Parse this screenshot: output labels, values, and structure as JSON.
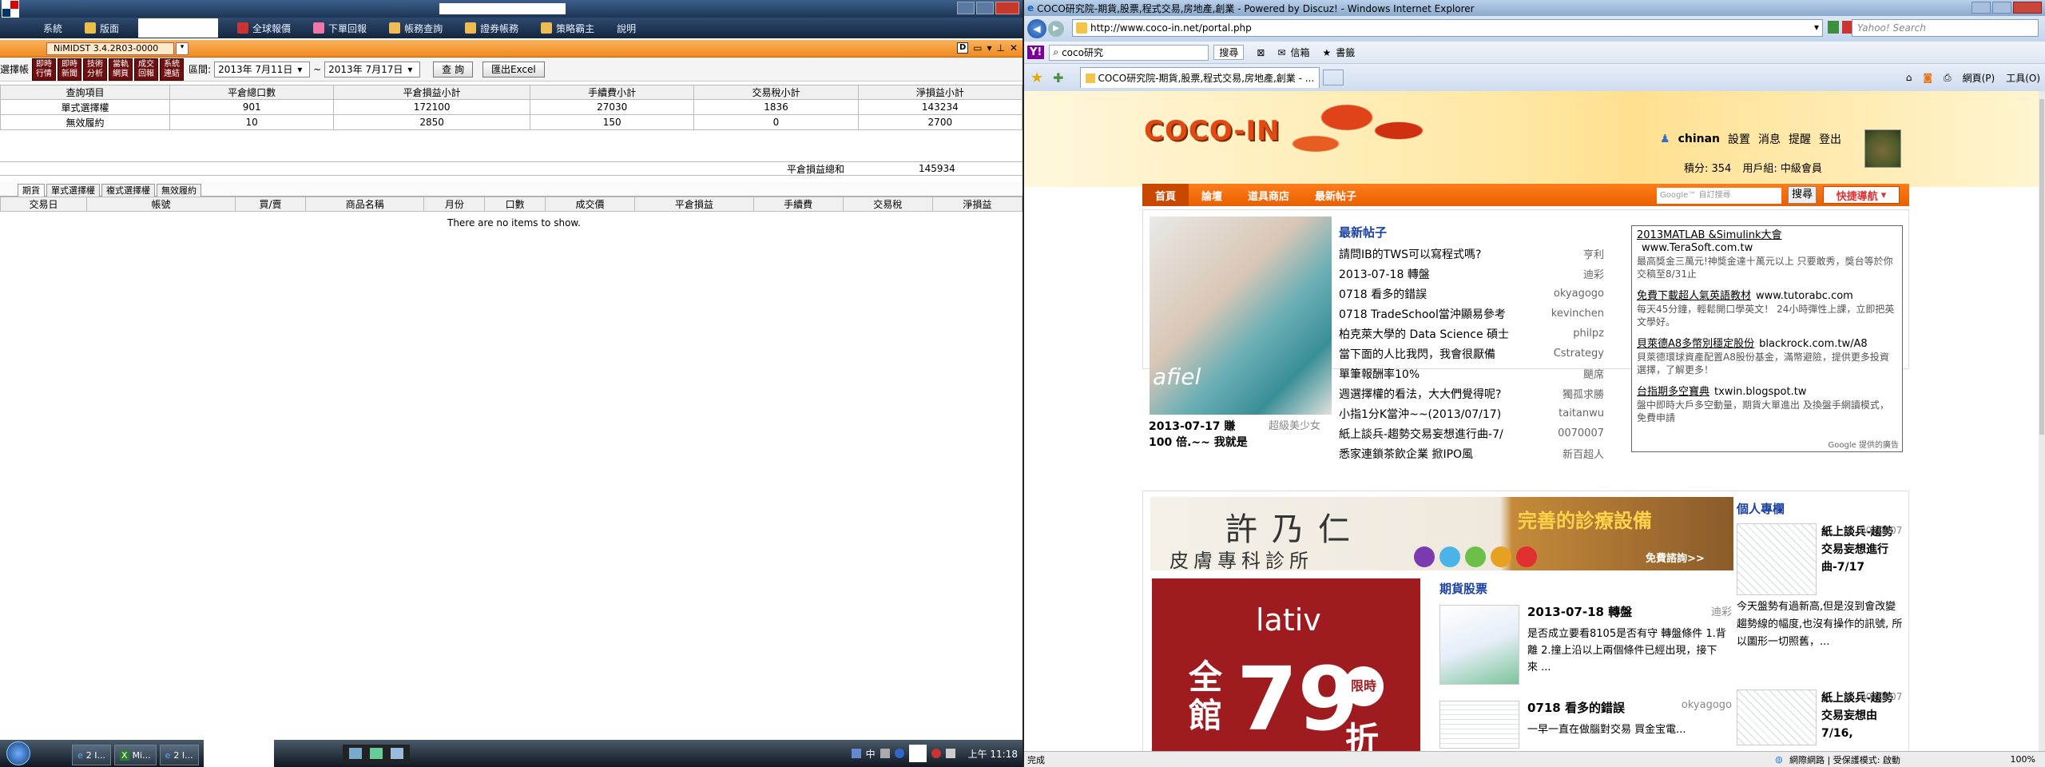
{
  "left_app": {
    "menu": [
      "系統",
      "版面",
      "全球報價",
      "下單回報",
      "帳務查詢",
      "證券帳務",
      "策略霸主",
      "說明"
    ],
    "tab_title": "NiMIDST 3.4.2R03-0000",
    "tool_buttons": [
      [
        "即時",
        "行情"
      ],
      [
        "即時",
        "新聞"
      ],
      [
        "技術",
        "分析"
      ],
      [
        "當軌",
        "網頁"
      ],
      [
        "成交",
        "回報"
      ],
      [
        "系統",
        "連結"
      ]
    ],
    "toolbar_label": "選擇帳",
    "interval_label": "區間:",
    "date_from": "2013年 7月11日",
    "date_to": "2013年 7月17日",
    "query_button": "查 詢",
    "export_button": "匯出Excel",
    "summary": {
      "headers": [
        "查詢項目",
        "平倉總口數",
        "平倉損益小計",
        "手續費小計",
        "交易稅小計",
        "淨損益小計"
      ],
      "rows": [
        [
          "單式選擇權",
          "901",
          "172100",
          "27030",
          "1836",
          "143234"
        ],
        [
          "無效履約",
          "10",
          "2850",
          "150",
          "0",
          "2700"
        ]
      ],
      "total_label": "平倉損益總和",
      "total_value": "145934"
    },
    "subtabs": [
      "期貨",
      "單式選擇權",
      "複式選擇權",
      "無效履約"
    ],
    "detail_headers": [
      "交易日",
      "帳號",
      "買/賣",
      "商品名稱",
      "月份",
      "口數",
      "成交價",
      "平倉損益",
      "手續費",
      "交易稅",
      "淨損益"
    ],
    "empty_text": "There are no items to show.",
    "taskbar_items": [
      "2 I...",
      "Mi...",
      "2 I..."
    ],
    "tray_text": "中",
    "clock": "上午 11:18"
  },
  "ie": {
    "window_title": "COCO研究院-期貨,股票,程式交易,房地產,創業 - Powered by Discuz! - Windows Internet Explorer",
    "address": "http://www.coco-in.net/portal.php",
    "search_placeholder": "Yahoo! Search",
    "yahoo_query": "coco研究",
    "yahoo_search_btn": "搜尋",
    "yahoo_mail": "信箱",
    "yahoo_bookmark": "書籤",
    "tab_title": "COCO研究院-期貨,股票,程式交易,房地產,創業 - ...",
    "cmd_page": "網頁(P)",
    "cmd_tools": "工具(O)",
    "status_left": "完成",
    "status_zone": "網際網路 | 受保護模式: 啟動",
    "zoom": "100%",
    "site": {
      "logo": "COCO-IN",
      "user": "chinan",
      "user_links": [
        "設置",
        "消息",
        "提醒",
        "登出"
      ],
      "points": "積分: 354",
      "group": "用戶組: 中級會員",
      "nav": [
        "首頁",
        "論壇",
        "道具商店",
        "最新帖子"
      ],
      "search_placeholder": "Google™ 自訂搜尋",
      "search_btn": "搜尋",
      "quicknav": "快捷導航",
      "featured_caption_1": "2013-07-17 賺",
      "featured_caption_2": "100 倍.~~ 我就是",
      "featured_author": "超級美少女",
      "latest_title": "最新帖子",
      "threads": [
        [
          "請問IB的TWS可以寫程式嗎?",
          "亨利"
        ],
        [
          "2013-07-18 轉盤",
          "迪彩"
        ],
        [
          "0718 看多的錯誤",
          "okyagogo"
        ],
        [
          "0718 TradeSchool當沖顯易參考",
          "kevinchen"
        ],
        [
          "柏克萊大學的 Data Science 碩士",
          "philpz"
        ],
        [
          "當下面的人比我閃，我會很厭備",
          "Cstrategy"
        ],
        [
          "單筆報酬率10%",
          "颶席"
        ],
        [
          "週選擇權的看法，大大們覺得呢?",
          "獨孤求勝"
        ],
        [
          "小指1分K當沖~~(2013/07/17)",
          "taitanwu"
        ],
        [
          "紙上談兵-趨勢交易妄想進行曲-7/",
          "0070007"
        ],
        [
          "悉家連鎖茶飲企業 掀IPO風",
          "新百超人"
        ]
      ],
      "ads": [
        [
          "2013MATLAB &Simulink大會",
          "www.TeraSoft.com.tw",
          "最高獎金三萬元!神獎金達十萬元以上 只要敢秀，獎台等於你 交稿至8/31止"
        ],
        [
          "免費下載超人氣英語教材",
          "www.tutorabc.com",
          "每天45分鐘，輕鬆開口學英文！ 24小時彈性上課，立即把英文學好。"
        ],
        [
          "貝萊德A8多幣別穩定股份",
          "blackrock.com.tw/A8",
          "貝萊德環球資產配置A8股份基金，滿幣避險，提供更多投資選擇，了解更多！"
        ],
        [
          "台指期多空寶典",
          "txwin.blogspot.tw",
          "盤中即時大戶多空動量，期貨大單進出 及換盤手網讀模式，免費申請"
        ]
      ],
      "ads_by": "Google 提供的廣告",
      "banner_name": "許乃仁",
      "banner_sub": "皮膚專科診所",
      "banner_promo": "完善的診療設備",
      "banner_free": "免費諮詢>>",
      "personal_title": "個人專欄",
      "personal": [
        [
          "紙上談兵-趨勢交易妄想進行曲-7/17",
          "0070007",
          "今天盤勢有過新高,但是沒到會改變趨勢線的幅度,也沒有操作的訊號, 所以圖形一切照舊，..."
        ],
        [
          "紙上談兵-趨勢交易妄想由7/16,",
          "0070007",
          ""
        ]
      ],
      "futures_title": "期貨股票",
      "futures_posts": [
        [
          "2013-07-18 轉盤",
          "迪彩",
          "是否成立要看8105是否有守 轉盤條件 1.背離 2.撞上沿以上兩個條件已經出現，接下來 ..."
        ],
        [
          "0718 看多的錯誤",
          "okyagogo",
          "一早一直在做腦對交易 買金宝電..."
        ]
      ],
      "lativ": "lativ",
      "lativ_left": "全館",
      "lativ_num": "79",
      "lativ_tag": "限時",
      "lativ_right": "折"
    }
  }
}
